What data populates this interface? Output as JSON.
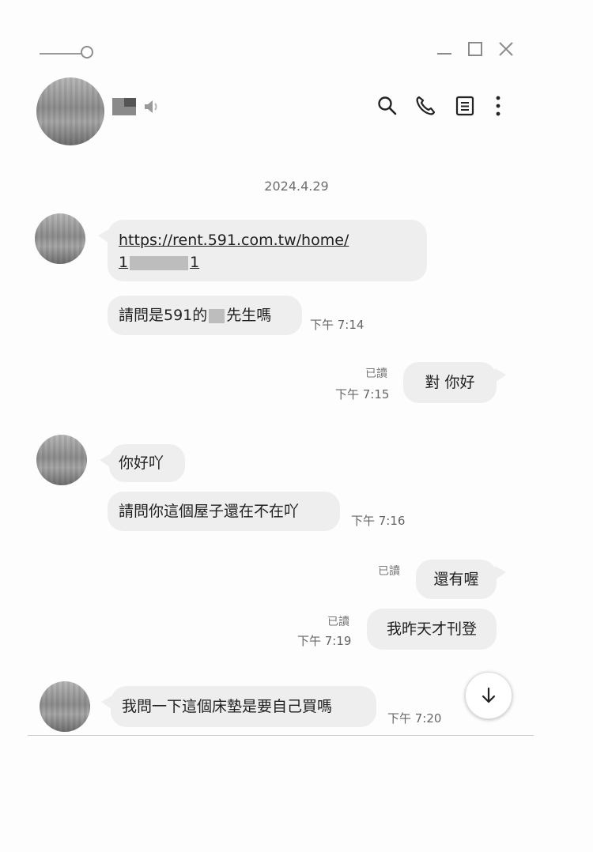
{
  "window": {
    "controls": [
      "minimize",
      "maximize",
      "close"
    ]
  },
  "header": {
    "icons": [
      "speaker-icon",
      "search-icon",
      "phone-icon",
      "notes-icon",
      "more-icon"
    ]
  },
  "chat": {
    "date": "2024.4.29",
    "messages": [
      {
        "side": "left",
        "link_line1": "https://rent.591.com.tw/home/",
        "link_line2_prefix": "1",
        "link_line2_suffix": "1"
      },
      {
        "side": "left",
        "text_prefix": "請問是591的",
        "text_suffix": "先生嗎",
        "time": "下午 7:14"
      },
      {
        "side": "right",
        "read": "已讀",
        "time": "下午 7:15",
        "text": "對 你好"
      },
      {
        "side": "left",
        "text": "你好吖"
      },
      {
        "side": "left",
        "text": "請問你這個屋子還在不在吖",
        "time": "下午 7:16"
      },
      {
        "side": "right",
        "read": "已讀",
        "text": "還有喔"
      },
      {
        "side": "right",
        "read": "已讀",
        "time": "下午 7:19",
        "text": "我昨天才刊登"
      },
      {
        "side": "left",
        "text": "我問一下這個床墊是要自己買嗎",
        "time": "下午 7:20"
      }
    ]
  },
  "colors": {
    "bubble": "#eeeeee",
    "background": "#fdfdfd",
    "meta_text": "#666666"
  }
}
